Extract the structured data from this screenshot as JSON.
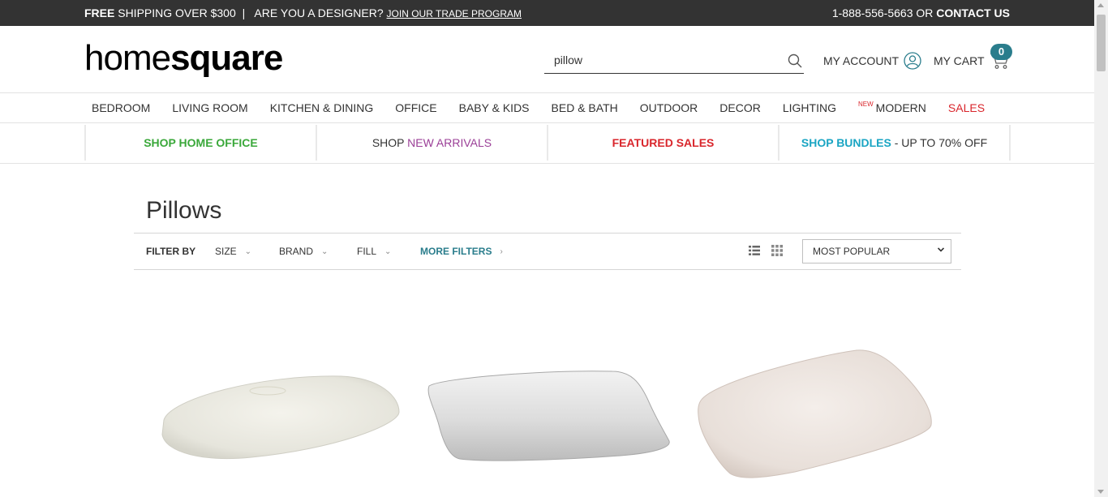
{
  "topbar": {
    "free_bold": "FREE",
    "free_rest": "SHIPPING OVER $300",
    "separator": "|",
    "designer_text": "ARE YOU A DESIGNER?",
    "trade_link": "JOIN OUR TRADE PROGRAM",
    "phone": "1-888-556-5663",
    "or": "OR",
    "contact": "CONTACT US"
  },
  "header": {
    "logo_home": "home",
    "logo_square": "square",
    "search_value": "pillow",
    "account_label": "MY ACCOUNT",
    "cart_label": "MY CART",
    "cart_count": "0"
  },
  "nav": {
    "items": [
      "BEDROOM",
      "LIVING ROOM",
      "KITCHEN & DINING",
      "OFFICE",
      "BABY & KIDS",
      "BED & BATH",
      "OUTDOOR",
      "DECOR",
      "LIGHTING"
    ],
    "new_badge": "NEW",
    "modern": "MODERN",
    "sales": "SALES"
  },
  "promo": {
    "home_office": "SHOP HOME OFFICE",
    "shop_word": "SHOP",
    "new_arrivals": "NEW ARRIVALS",
    "featured_sales": "FEATURED SALES",
    "bundles": "SHOP BUNDLES",
    "bundles_suffix": "- UP TO 70% OFF"
  },
  "page": {
    "title": "Pillows"
  },
  "filters": {
    "label": "FILTER BY",
    "size": "SIZE",
    "brand": "BRAND",
    "fill": "FILL",
    "more": "MORE FILTERS",
    "sort_selected": "MOST POPULAR"
  },
  "icons": {
    "search": "search-icon",
    "account": "user-icon",
    "cart": "cart-icon",
    "list_view": "list-view-icon",
    "grid_view": "grid-view-icon"
  },
  "colors": {
    "topbar": "#333333",
    "teal": "#2a7d8c",
    "green": "#3aa83a",
    "purple": "#9b3f97",
    "red": "#d9262c",
    "cyan": "#1aa5c3"
  }
}
